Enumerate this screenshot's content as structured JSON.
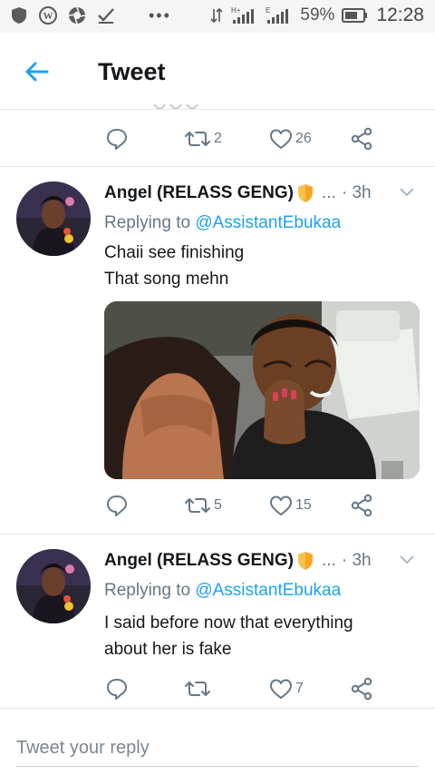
{
  "status_bar": {
    "icons_left": [
      "shield-icon",
      "wordpress-icon",
      "aperture-icon",
      "checkmark-icon"
    ],
    "overflow": "•••",
    "battery_percent": "59%",
    "time": "12:28"
  },
  "appbar": {
    "back_icon": "arrow-left-icon",
    "title": "Tweet"
  },
  "top_tweet_actions": {
    "retweets": "2",
    "likes": "26"
  },
  "tweets": [
    {
      "name": "Angel (RELASS GENG)",
      "ellipsis": "...",
      "time": "· 3h",
      "replying_to_label": "Replying to",
      "replying_to_handle": "@AssistantEbukaa",
      "text_line1": "Chaii see finishing",
      "text_line2": "That song mehn",
      "has_media": true,
      "retweets": "5",
      "likes": "15"
    },
    {
      "name": "Angel (RELASS GENG)",
      "ellipsis": "...",
      "time": "· 3h",
      "replying_to_label": "Replying to",
      "replying_to_handle": "@AssistantEbukaa",
      "text_line1": "I said before now that everything",
      "text_line2": "about her is fake",
      "has_media": false,
      "retweets": "",
      "likes": "7"
    }
  ],
  "composer": {
    "placeholder": "Tweet your reply"
  },
  "colors": {
    "accent": "#1da1f2",
    "muted": "#657786",
    "text": "#14171a",
    "divider": "#e1e8ed",
    "shield": "#f5a623"
  }
}
